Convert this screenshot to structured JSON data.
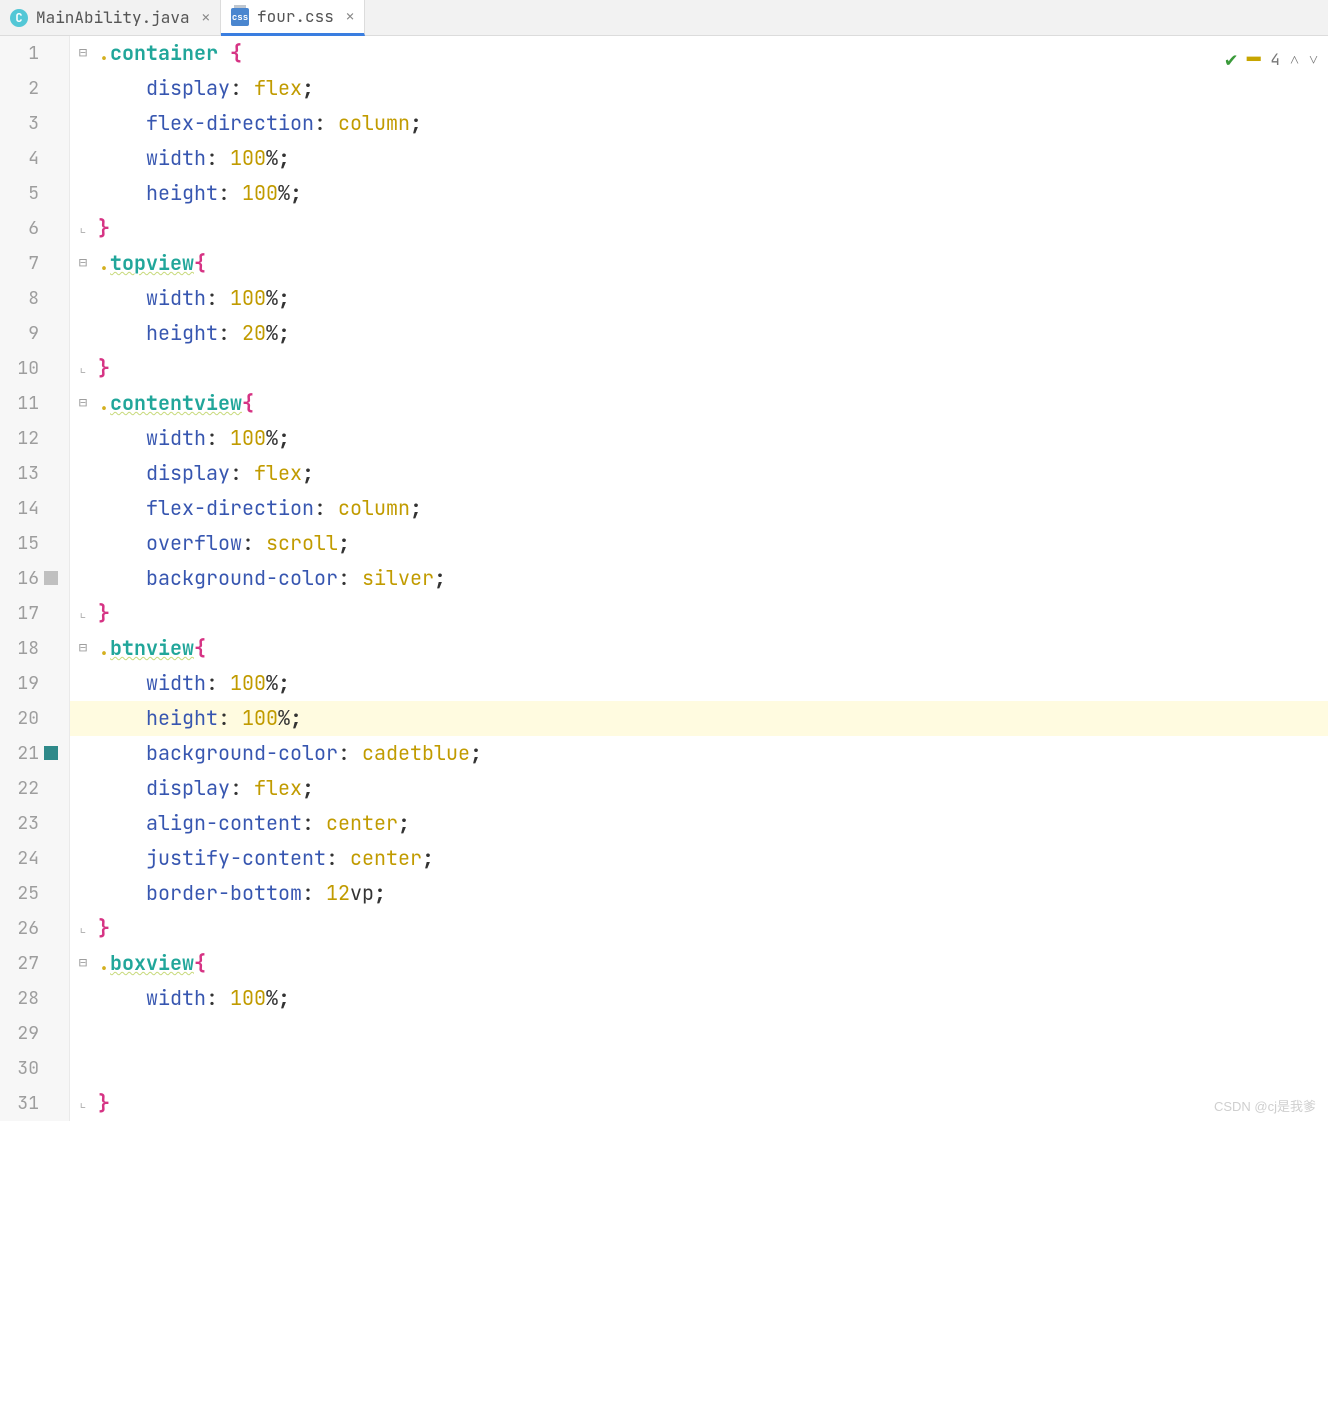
{
  "tabs": [
    {
      "label": "MainAbility.java",
      "kind": "class",
      "active": false
    },
    {
      "label": "four.css",
      "kind": "css",
      "active": true
    }
  ],
  "inspections": {
    "count": "4"
  },
  "watermark": "CSDN @cj是我爹",
  "code_lines": [
    {
      "n": 1,
      "fold": "open",
      "tokens": [
        [
          "dot",
          "."
        ],
        [
          "sel",
          "container"
        ],
        [
          "punc",
          " "
        ],
        [
          "brace",
          "{"
        ]
      ]
    },
    {
      "n": 2,
      "tokens": [
        [
          "indent",
          "    "
        ],
        [
          "prop",
          "display"
        ],
        [
          "punc",
          ": "
        ],
        [
          "val",
          "flex"
        ],
        [
          "semi",
          ";"
        ]
      ]
    },
    {
      "n": 3,
      "tokens": [
        [
          "indent",
          "    "
        ],
        [
          "prop",
          "flex-direction"
        ],
        [
          "punc",
          ": "
        ],
        [
          "val",
          "column"
        ],
        [
          "semi",
          ";"
        ]
      ]
    },
    {
      "n": 4,
      "tokens": [
        [
          "indent",
          "    "
        ],
        [
          "prop",
          "width"
        ],
        [
          "punc",
          ": "
        ],
        [
          "val",
          "100"
        ],
        [
          "punc",
          "%"
        ],
        [
          "semi",
          ";"
        ]
      ]
    },
    {
      "n": 5,
      "tokens": [
        [
          "indent",
          "    "
        ],
        [
          "prop",
          "height"
        ],
        [
          "punc",
          ": "
        ],
        [
          "val",
          "100"
        ],
        [
          "punc",
          "%"
        ],
        [
          "semi",
          ";"
        ]
      ]
    },
    {
      "n": 6,
      "fold": "close",
      "tokens": [
        [
          "brace",
          "}"
        ]
      ]
    },
    {
      "n": 7,
      "fold": "open",
      "tokens": [
        [
          "dot",
          "."
        ],
        [
          "selu",
          "topview"
        ],
        [
          "brace",
          "{"
        ]
      ]
    },
    {
      "n": 8,
      "tokens": [
        [
          "indent",
          "    "
        ],
        [
          "prop",
          "width"
        ],
        [
          "punc",
          ": "
        ],
        [
          "val",
          "100"
        ],
        [
          "punc",
          "%"
        ],
        [
          "semi",
          ";"
        ]
      ]
    },
    {
      "n": 9,
      "tokens": [
        [
          "indent",
          "    "
        ],
        [
          "prop",
          "height"
        ],
        [
          "punc",
          ": "
        ],
        [
          "val",
          "20"
        ],
        [
          "punc",
          "%"
        ],
        [
          "semi",
          ";"
        ]
      ]
    },
    {
      "n": 10,
      "fold": "close",
      "tokens": [
        [
          "brace",
          "}"
        ]
      ]
    },
    {
      "n": 11,
      "fold": "open",
      "tokens": [
        [
          "dot",
          "."
        ],
        [
          "selu",
          "contentview"
        ],
        [
          "brace",
          "{"
        ]
      ]
    },
    {
      "n": 12,
      "tokens": [
        [
          "indent",
          "    "
        ],
        [
          "prop",
          "width"
        ],
        [
          "punc",
          ": "
        ],
        [
          "val",
          "100"
        ],
        [
          "punc",
          "%"
        ],
        [
          "semi",
          ";"
        ]
      ]
    },
    {
      "n": 13,
      "tokens": [
        [
          "indent",
          "    "
        ],
        [
          "prop",
          "display"
        ],
        [
          "punc",
          ": "
        ],
        [
          "val",
          "flex"
        ],
        [
          "semi",
          ";"
        ]
      ]
    },
    {
      "n": 14,
      "tokens": [
        [
          "indent",
          "    "
        ],
        [
          "prop",
          "flex-direction"
        ],
        [
          "punc",
          ": "
        ],
        [
          "val",
          "column"
        ],
        [
          "semi",
          ";"
        ]
      ]
    },
    {
      "n": 15,
      "tokens": [
        [
          "indent",
          "    "
        ],
        [
          "prop",
          "overflow"
        ],
        [
          "punc",
          ": "
        ],
        [
          "val",
          "scroll"
        ],
        [
          "semi",
          ";"
        ]
      ]
    },
    {
      "n": 16,
      "marker": "silver",
      "tokens": [
        [
          "indent",
          "    "
        ],
        [
          "prop",
          "background-color"
        ],
        [
          "punc",
          ": "
        ],
        [
          "val",
          "silver"
        ],
        [
          "semi",
          ";"
        ]
      ]
    },
    {
      "n": 17,
      "fold": "close",
      "tokens": [
        [
          "brace",
          "}"
        ]
      ]
    },
    {
      "n": 18,
      "fold": "open",
      "tokens": [
        [
          "dot",
          "."
        ],
        [
          "selu",
          "btnview"
        ],
        [
          "brace",
          "{"
        ]
      ]
    },
    {
      "n": 19,
      "tokens": [
        [
          "indent",
          "    "
        ],
        [
          "prop",
          "width"
        ],
        [
          "punc",
          ": "
        ],
        [
          "val",
          "100"
        ],
        [
          "punc",
          "%"
        ],
        [
          "semi",
          ";"
        ]
      ]
    },
    {
      "n": 20,
      "hl": true,
      "tokens": [
        [
          "indent",
          "    "
        ],
        [
          "prop",
          "height"
        ],
        [
          "punc",
          ": "
        ],
        [
          "val",
          "100"
        ],
        [
          "punc",
          "%"
        ],
        [
          "semi",
          ";"
        ]
      ]
    },
    {
      "n": 21,
      "marker": "cadetblue",
      "tokens": [
        [
          "indent",
          "    "
        ],
        [
          "prop",
          "background-color"
        ],
        [
          "punc",
          ": "
        ],
        [
          "val",
          "cadetblue"
        ],
        [
          "semi",
          ";"
        ]
      ]
    },
    {
      "n": 22,
      "tokens": [
        [
          "indent",
          "    "
        ],
        [
          "prop",
          "display"
        ],
        [
          "punc",
          ": "
        ],
        [
          "val",
          "flex"
        ],
        [
          "semi",
          ";"
        ]
      ]
    },
    {
      "n": 23,
      "tokens": [
        [
          "indent",
          "    "
        ],
        [
          "prop",
          "align-content"
        ],
        [
          "punc",
          ": "
        ],
        [
          "val",
          "center"
        ],
        [
          "semi",
          ";"
        ]
      ]
    },
    {
      "n": 24,
      "tokens": [
        [
          "indent",
          "    "
        ],
        [
          "prop",
          "justify-content"
        ],
        [
          "punc",
          ": "
        ],
        [
          "val",
          "center"
        ],
        [
          "semi",
          ";"
        ]
      ]
    },
    {
      "n": 25,
      "tokens": [
        [
          "indent",
          "    "
        ],
        [
          "prop",
          "border-bottom"
        ],
        [
          "punc",
          ": "
        ],
        [
          "val",
          "12"
        ],
        [
          "punc",
          "vp"
        ],
        [
          "semi",
          ";"
        ]
      ]
    },
    {
      "n": 26,
      "fold": "close",
      "tokens": [
        [
          "brace",
          "}"
        ]
      ]
    },
    {
      "n": 27,
      "fold": "open",
      "tokens": [
        [
          "dot",
          "."
        ],
        [
          "selu",
          "boxview"
        ],
        [
          "brace",
          "{"
        ]
      ]
    },
    {
      "n": 28,
      "tokens": [
        [
          "indent",
          "    "
        ],
        [
          "prop",
          "width"
        ],
        [
          "punc",
          ": "
        ],
        [
          "val",
          "100"
        ],
        [
          "punc",
          "%"
        ],
        [
          "semi",
          ";"
        ]
      ]
    },
    {
      "n": 29,
      "tokens": []
    },
    {
      "n": 30,
      "tokens": []
    },
    {
      "n": 31,
      "fold": "close",
      "tokens": [
        [
          "brace",
          "}"
        ]
      ]
    }
  ]
}
